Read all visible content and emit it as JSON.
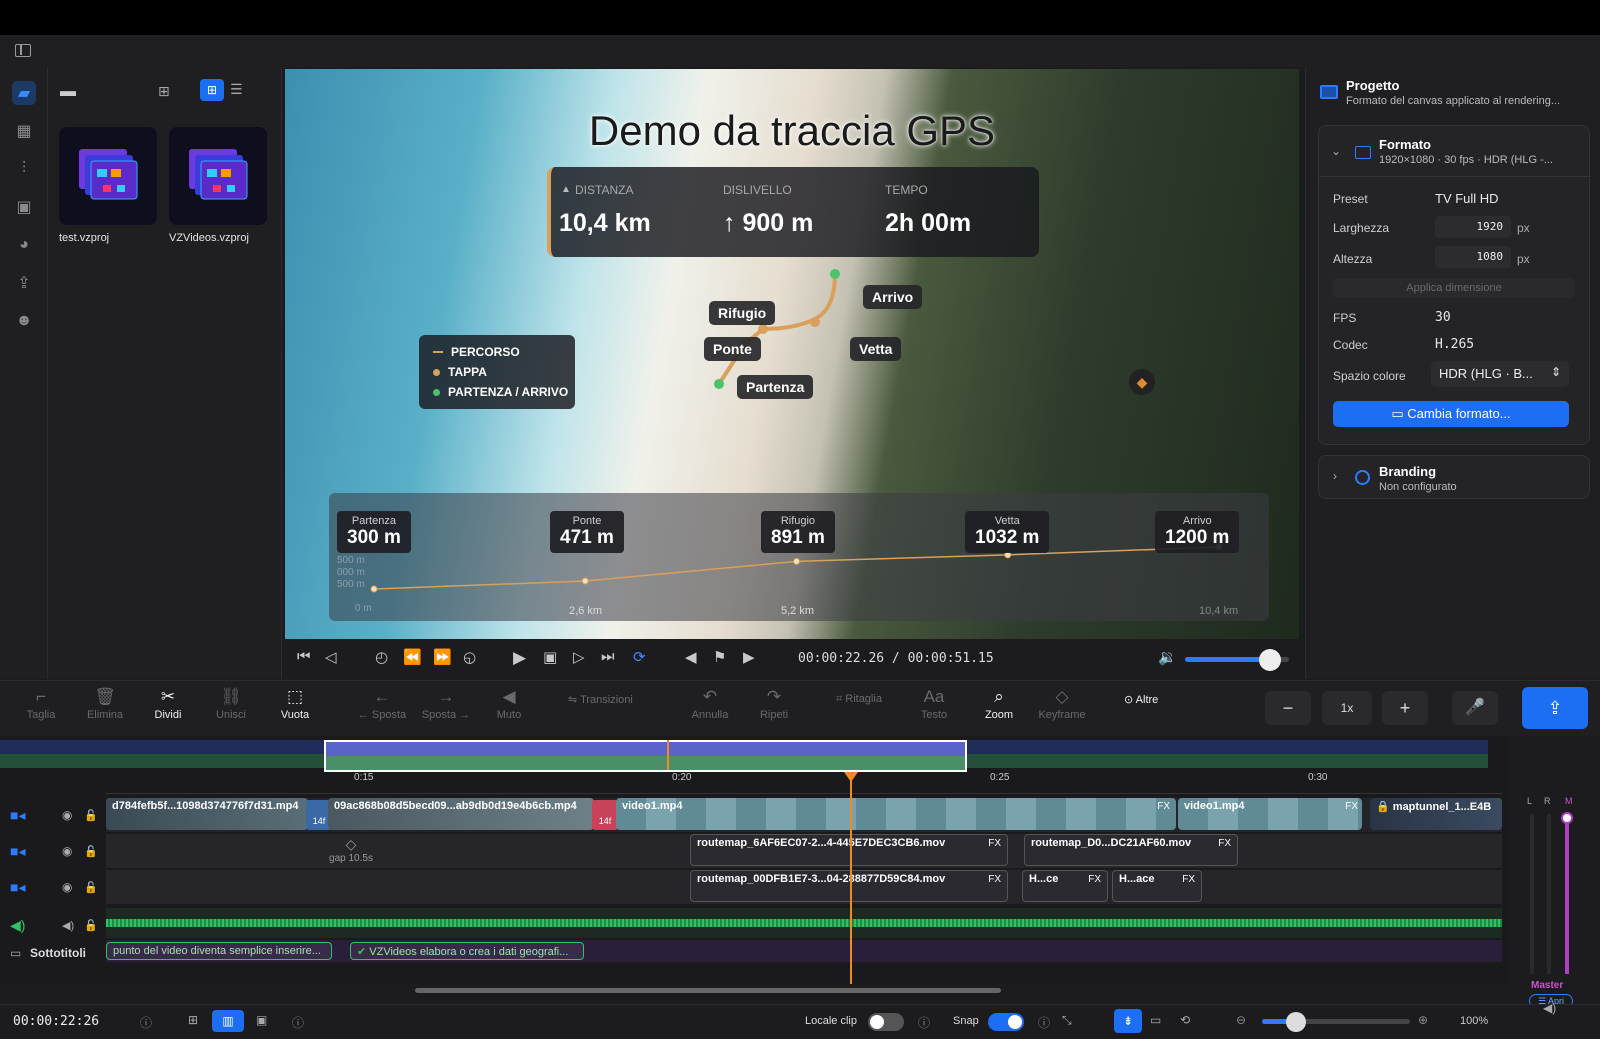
{
  "media": {
    "items": [
      {
        "label": "test.vzproj"
      },
      {
        "label": "VZVideos.vzproj"
      }
    ]
  },
  "preview": {
    "title": "Demo da traccia GPS",
    "stats": [
      {
        "label": "DISTANZA",
        "value": "10,4 km"
      },
      {
        "label": "DISLIVELLO",
        "value": "↑ 900 m"
      },
      {
        "label": "TEMPO",
        "value": "2h 00m"
      }
    ],
    "legend": [
      "PERCORSO",
      "TAPPA",
      "PARTENZA / ARRIVO"
    ],
    "map_tags": [
      "Rifugio",
      "Arrivo",
      "Ponte",
      "Vetta",
      "Partenza"
    ],
    "elevation": [
      {
        "name": "Partenza",
        "value": "300 m"
      },
      {
        "name": "Ponte",
        "value": "471 m"
      },
      {
        "name": "Rifugio",
        "value": "891 m"
      },
      {
        "name": "Vetta",
        "value": "1032 m"
      },
      {
        "name": "Arrivo",
        "value": "1200 m"
      }
    ],
    "elev_axis": [
      "2,6 km",
      "5,2 km",
      "10,4 km"
    ],
    "elev_y": [
      "500 m",
      "000 m",
      "500 m",
      "0 m"
    ]
  },
  "transport": {
    "timecode": "00:00:22.26 / 00:00:51.15",
    "volume": 0.82
  },
  "inspector": {
    "project_title": "Progetto",
    "project_sub": "Formato del canvas applicato al rendering...",
    "format_title": "Formato",
    "format_sub": "1920×1080 · 30 fps · HDR (HLG -...",
    "preset_label": "Preset",
    "preset_value": "TV Full HD",
    "width_label": "Larghezza",
    "width_value": "1920",
    "height_label": "Altezza",
    "height_value": "1080",
    "unit": "px",
    "apply_label": "Applica dimensione",
    "fps_label": "FPS",
    "fps_value": "30",
    "codec_label": "Codec",
    "codec_value": "H.265",
    "color_label": "Spazio colore",
    "color_value": "HDR (HLG · B...",
    "change_button": "Cambia formato...",
    "branding_title": "Branding",
    "branding_sub": "Non configurato"
  },
  "toolbar": {
    "tools": [
      "Taglia",
      "Elimina",
      "Dividi",
      "Unisci",
      "Vuota",
      "← Sposta",
      "Sposta →",
      "Muto",
      "Transizioni",
      "Annulla",
      "Ripeti",
      "Ritaglia",
      "Testo",
      "Zoom",
      "Keyframe",
      "Altre"
    ],
    "speed": "1x"
  },
  "timeline": {
    "ruler": [
      "0:15",
      "0:20",
      "0:25",
      "0:30"
    ],
    "v1_clips": [
      "d784fefb5f...1098d374776f7d31.mp4",
      "09ac868b08d5becd09...ab9db0d19e4b6cb.mp4",
      "video1.mp4",
      "video1.mp4",
      "maptunnel_1...E4B"
    ],
    "v2_clips": [
      "routemap_6AF6EC07-2...4-445E7DEC3CB6.mov",
      "routemap_D0...DC21AF60.mov"
    ],
    "v3_clips": [
      "routemap_00DFB1E7-3...04-288877D59C84.mov",
      "H...ce",
      "H...ace"
    ],
    "gap_label": "gap 10.5s",
    "subtitles_label": "Sottotitoli",
    "subtitles": [
      "punto del video diventa semplice inserire...",
      "VZVideos elabora o crea i dati geografi..."
    ],
    "fx": "FX",
    "badges": [
      "14f",
      "14f"
    ],
    "meter": {
      "l": "L",
      "r": "R",
      "m": "M",
      "master": "Master",
      "open": "Apri"
    }
  },
  "bottom": {
    "timecode": "00:00:22:26",
    "locale_label": "Locale clip",
    "snap_label": "Snap",
    "zoom": "100%"
  },
  "chart_data": {
    "type": "line",
    "x": [
      0,
      2.6,
      5.2,
      7.8,
      10.4
    ],
    "series": [
      {
        "values": [
          300,
          471,
          891,
          1032,
          1200
        ]
      }
    ],
    "xlabel": "",
    "ylabel": "",
    "ylim": [
      0,
      1500
    ]
  },
  "colors": {
    "accent": "#1c6ef2",
    "route": "#d9a05b",
    "playhead": "#f08a24",
    "audio": "#2ec466"
  }
}
